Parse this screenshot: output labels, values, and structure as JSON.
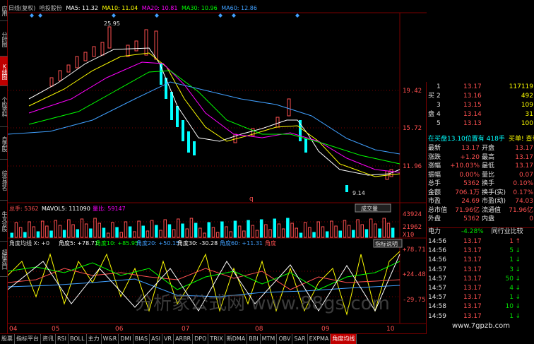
{
  "header": {
    "title": "日线(复权)",
    "stock_name": "哈投股份",
    "ma5": "MA5: 11.32",
    "ma10": "MA10: 11.04",
    "ma20": "MA20: 10.81",
    "ma30": "MA30: 10.96",
    "ma60": "MA60: 12.86"
  },
  "left_tabs": [
    "应用",
    "分时图",
    "K线图",
    "个股资料",
    "自选股",
    "综合排名",
    "牛叉诊股",
    "超级盘口"
  ],
  "price_chart": {
    "high_label": "25.95",
    "low_label": "9.14",
    "q_marker": "q",
    "axis": [
      "19.42",
      "15.72",
      "11.96"
    ]
  },
  "volume_panel": {
    "label": "总手: 5362",
    "mavol": "MAVOL5: 111090",
    "ratio": "量比: 59147",
    "button": "成交量",
    "axis": [
      "43924",
      "21962",
      "X10"
    ]
  },
  "angle_panel": {
    "label": "角度均线 X: +0",
    "a5": "角度5: +78.71",
    "a10": "角度10: +85.95",
    "a20": "角度20: +50.15",
    "a30": "角度30: -30.28",
    "a60": "角度60: +11.31",
    "a_title": "角度",
    "button": "指标说明",
    "axis": [
      "+78.71",
      "+24.48",
      "-29.75"
    ],
    "watermark": "分析家公式网 www.88gs.com"
  },
  "x_axis": [
    "04",
    "05",
    "06",
    "07",
    "08",
    "09",
    "10"
  ],
  "quote": {
    "orders": [
      {
        "side": "",
        "level": "1",
        "price": "13.17",
        "vol": "117119"
      },
      {
        "side": "买",
        "level": "2",
        "price": "13.16",
        "vol": "492"
      },
      {
        "side": "",
        "level": "3",
        "price": "13.15",
        "vol": "109"
      },
      {
        "side": "盘",
        "level": "4",
        "price": "13.14",
        "vol": "31"
      },
      {
        "side": "",
        "level": "5",
        "price": "13.13",
        "vol": "100"
      }
    ],
    "position_note": "在买盘13.10位置有 418手",
    "buy_detail": "买单! 查看详细",
    "rows": [
      {
        "k1": "最新",
        "v1": "13.17",
        "k2": "开盘",
        "v2": "13.17"
      },
      {
        "k1": "涨跌",
        "v1": "+1.20",
        "k2": "最高",
        "v2": "13.17"
      },
      {
        "k1": "涨幅",
        "v1": "+10.03%",
        "k2": "最低",
        "v2": "13.17"
      },
      {
        "k1": "振幅",
        "v1": "0.00%",
        "k2": "量比",
        "v2": "0.07"
      },
      {
        "k1": "总手",
        "v1": "5362",
        "k2": "换手",
        "v2": "0.10%"
      },
      {
        "k1": "金额",
        "v1": "706.1万",
        "k2": "换手(实)",
        "v2": "0.17%"
      },
      {
        "k1": "市盈",
        "v1": "24.69",
        "k2": "市盈(动)",
        "v2": "74.03"
      },
      {
        "k1": "总市值",
        "v1": "71.96亿",
        "k2": "流通值",
        "v2": "71.96亿"
      },
      {
        "k1": "外盘",
        "v1": "5362",
        "k2": "内盘",
        "v2": "0"
      }
    ],
    "sector": "电力",
    "sector_pct": "-4.28%",
    "industry_link": "同行业比较",
    "ticks": [
      {
        "time": "14:56",
        "price": "13.17",
        "vol": "1",
        "dir": "up"
      },
      {
        "time": "14:56",
        "price": "13.17",
        "vol": "5",
        "dir": "down"
      },
      {
        "time": "14:56",
        "price": "13.17",
        "vol": "1",
        "dir": "down"
      },
      {
        "time": "14:57",
        "price": "13.17",
        "vol": "3",
        "dir": "down"
      },
      {
        "time": "14:57",
        "price": "13.17",
        "vol": "50",
        "dir": "down"
      },
      {
        "time": "14:57",
        "price": "13.17",
        "vol": "4",
        "dir": "down"
      },
      {
        "time": "14:57",
        "price": "13.17",
        "vol": "1",
        "dir": "down"
      },
      {
        "time": "14:58",
        "price": "13.17",
        "vol": "10",
        "dir": "down"
      },
      {
        "time": "14:59",
        "price": "13.17",
        "vol": "1",
        "dir": "down"
      }
    ],
    "site": "www.7gpzb.com"
  },
  "bottom_tabs": [
    "股票",
    "指标平台",
    "资讯",
    "RSI",
    "BOLL",
    "主力",
    "W&R",
    "DMI",
    "BIAS",
    "ASI",
    "VR",
    "ARBR",
    "DPO",
    "TRIX",
    "新DMA",
    "BBI",
    "MTM",
    "OBV",
    "SAR",
    "EXPMA",
    "角度均线"
  ],
  "colors": {
    "up": "#ff5050",
    "down": "#00e000",
    "ma20": "#ff00ff",
    "ma30": "#00ff00",
    "ma60": "#40a0ff",
    "border": "#7a0000"
  }
}
